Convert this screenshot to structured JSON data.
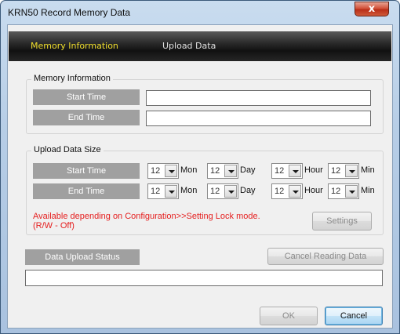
{
  "window": {
    "title": "KRN50 Record Memory Data",
    "close_label": "x"
  },
  "tabs": [
    {
      "label": "Memory Information",
      "active": true
    },
    {
      "label": "Upload Data",
      "active": false
    }
  ],
  "memory_information": {
    "group_title": "Memory Information",
    "start_time_label": "Start Time",
    "start_time_value": "",
    "end_time_label": "End Time",
    "end_time_value": ""
  },
  "upload_data_size": {
    "group_title": "Upload Data Size",
    "start_time_label": "Start Time",
    "end_time_label": "End Time",
    "start": {
      "mon": "12",
      "day": "12",
      "hour": "12",
      "min": "12"
    },
    "end": {
      "mon": "12",
      "day": "12",
      "hour": "12",
      "min": "12"
    },
    "units": {
      "mon": "Mon",
      "day": "Day",
      "hour": "Hour",
      "min": "Min"
    },
    "warning_line1": "Available depending on Configuration>>Setting Lock mode.",
    "warning_line2": "(R/W - Off)",
    "settings_label": "Settings"
  },
  "status": {
    "label": "Data Upload Status",
    "cancel_reading_label": "Cancel Reading Data",
    "status_value": ""
  },
  "footer": {
    "ok_label": "OK",
    "cancel_label": "Cancel"
  },
  "colors": {
    "tab_active": "#f0de2c",
    "warning": "#e51e1e",
    "label_box": "#a0a0a0"
  }
}
